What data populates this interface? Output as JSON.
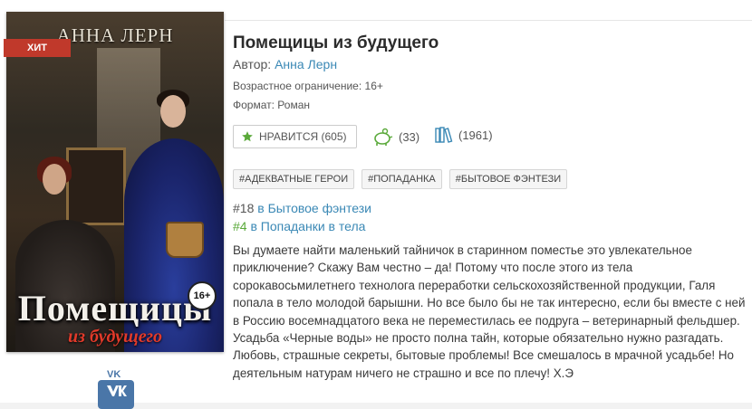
{
  "cover": {
    "author": "АННА ЛЕРН",
    "title": "Помещицы",
    "subtitle": "из будущего",
    "hit_badge": "ХИТ",
    "age_badge": "16+"
  },
  "social": {
    "vk_label": "VK"
  },
  "book": {
    "title": "Помещицы из будущего",
    "author_label": "Автор:",
    "author_name": "Анна Лерн",
    "age_restriction": "Возрастное ограничение: 16+",
    "format": "Формат: Роман"
  },
  "actions": {
    "like_label": "НРАВИТСЯ (605)",
    "rewards_count": "(33)",
    "library_count": "(1961)"
  },
  "tags": [
    "#АДЕКВАТНЫЕ ГЕРОИ",
    "#ПОПАДАНКА",
    "#БЫТОВОЕ ФЭНТЕЗИ"
  ],
  "ranks": [
    {
      "number": "#18",
      "word": "в",
      "genre": "Бытовое фэнтези"
    },
    {
      "number": "#4",
      "word": "в",
      "genre": "Попаданки в тела"
    }
  ],
  "description": "Вы думаете найти маленький тайничок в старинном поместье это увлекательное приключение? Скажу Вам честно – да! Потому что после этого из тела сорокавосьмилетнего технолога переработки сельскохозяйственной продукции, Галя попала в тело молодой барышни. Но все было бы не так интересно, если бы вместе с ней в Россию восемнадцатого века не переместилась ее подруга – ветеринарный фельдшер. Усадьба «Черные воды» не просто полна тайн, которые обязательно нужно разгадать. Любовь, страшные секреты, бытовые проблемы! Все смешалось в мрачной усадьбе! Но деятельным натурам ничего не страшно и все по плечу! Х.Э",
  "colors": {
    "link": "#3a88b5",
    "rank_green": "#5aa93a",
    "hit_red": "#c0392b",
    "like_star": "#5aa93a"
  }
}
